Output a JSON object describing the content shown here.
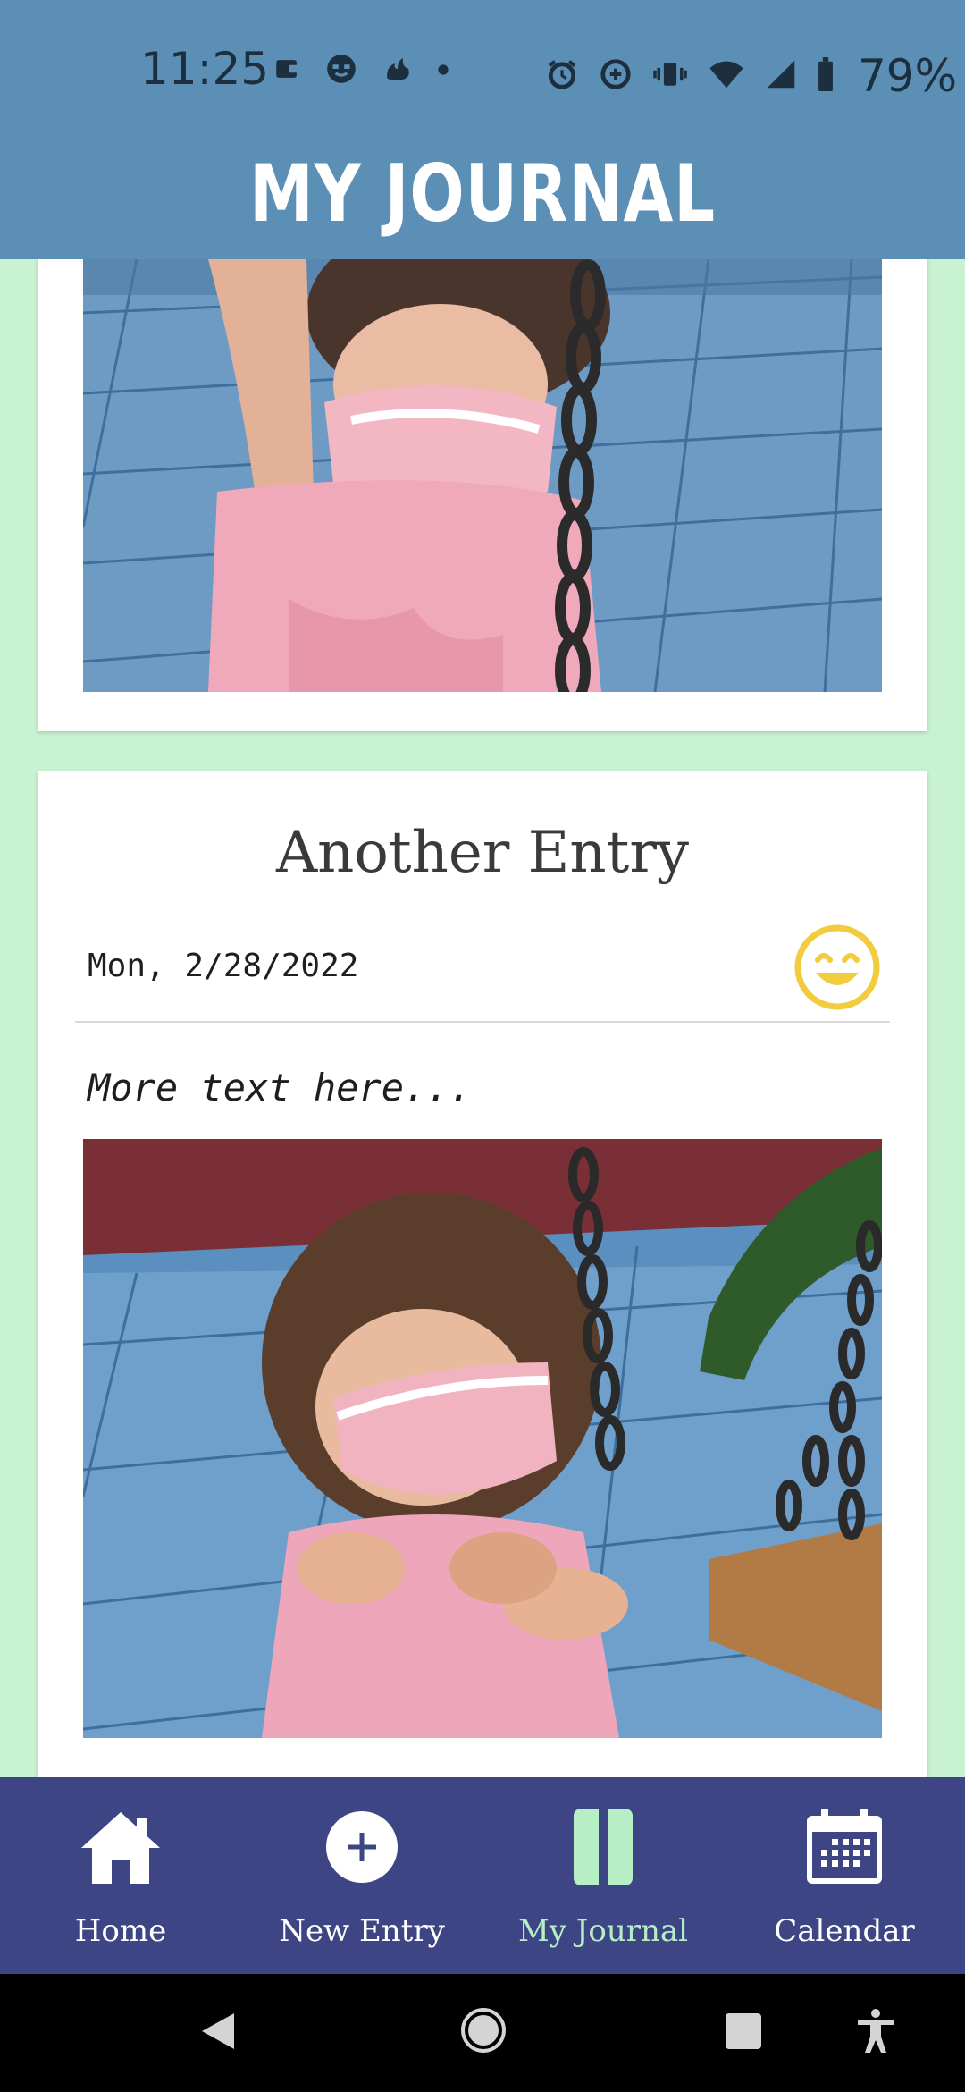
{
  "status_bar": {
    "time": "11:25",
    "battery": "79%"
  },
  "header": {
    "title": "MY JOURNAL"
  },
  "entries": [
    {
      "photo_alt": "Child in pink dress and mask holding swing chain"
    },
    {
      "title": "Another Entry",
      "date": "Mon, 2/28/2022",
      "mood_icon": "grinning-face-icon",
      "text": "More text here...",
      "photo_alt": "Child in pink dress and mask next to swing"
    }
  ],
  "bottom_nav": {
    "items": [
      {
        "label": "Home",
        "icon": "home-icon"
      },
      {
        "label": "New Entry",
        "icon": "plus-circle-icon"
      },
      {
        "label": "My Journal",
        "icon": "journal-icon",
        "active": true
      },
      {
        "label": "Calendar",
        "icon": "calendar-icon"
      }
    ]
  },
  "colors": {
    "header_bg": "#5b8fb5",
    "page_bg": "#c9f2d2",
    "nav_bg": "#3d4585",
    "nav_active": "#b6efc6",
    "mood": "#f2cc3c"
  }
}
